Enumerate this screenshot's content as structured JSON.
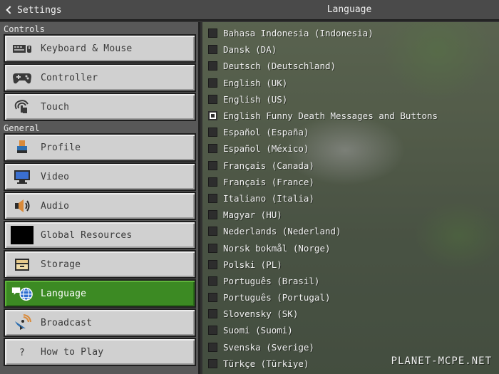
{
  "header": {
    "back_label": "Settings",
    "title": "Language"
  },
  "sidebar": {
    "sections": [
      {
        "label": "Controls"
      },
      {
        "label": "General"
      }
    ],
    "items": [
      {
        "label": "Keyboard & Mouse",
        "icon": "keyboard-mouse-icon"
      },
      {
        "label": "Controller",
        "icon": "gamepad-icon"
      },
      {
        "label": "Touch",
        "icon": "touch-hand-icon"
      },
      {
        "label": "Profile",
        "icon": "profile-icon"
      },
      {
        "label": "Video",
        "icon": "monitor-icon"
      },
      {
        "label": "Audio",
        "icon": "speaker-icon"
      },
      {
        "label": "Global Resources",
        "icon": "global-resources-icon"
      },
      {
        "label": "Storage",
        "icon": "storage-box-icon"
      },
      {
        "label": "Language",
        "icon": "language-globe-icon",
        "active": true
      },
      {
        "label": "Broadcast",
        "icon": "broadcast-satellite-icon"
      },
      {
        "label": "How to Play",
        "icon": "question-icon"
      }
    ],
    "active_color": "#3c8a23"
  },
  "languages": [
    {
      "label": "Bahasa Indonesia (Indonesia)",
      "checked": false
    },
    {
      "label": "Dansk (DA)",
      "checked": false
    },
    {
      "label": "Deutsch (Deutschland)",
      "checked": false
    },
    {
      "label": "English (UK)",
      "checked": false
    },
    {
      "label": "English (US)",
      "checked": false
    },
    {
      "label": "English Funny Death Messages and Buttons",
      "checked": true
    },
    {
      "label": "Español (España)",
      "checked": false
    },
    {
      "label": "Español (México)",
      "checked": false
    },
    {
      "label": "Français (Canada)",
      "checked": false
    },
    {
      "label": "Français (France)",
      "checked": false
    },
    {
      "label": "Italiano (Italia)",
      "checked": false
    },
    {
      "label": "Magyar (HU)",
      "checked": false
    },
    {
      "label": "Nederlands (Nederland)",
      "checked": false
    },
    {
      "label": "Norsk bokmål (Norge)",
      "checked": false
    },
    {
      "label": "Polski (PL)",
      "checked": false
    },
    {
      "label": "Português (Brasil)",
      "checked": false
    },
    {
      "label": "Português (Portugal)",
      "checked": false
    },
    {
      "label": "Slovensky (SK)",
      "checked": false
    },
    {
      "label": "Suomi (Suomi)",
      "checked": false
    },
    {
      "label": "Svenska (Sverige)",
      "checked": false
    },
    {
      "label": "Türkçe (Türkiye)",
      "checked": false
    }
  ],
  "watermark": "PLANET-MCPE.NET"
}
